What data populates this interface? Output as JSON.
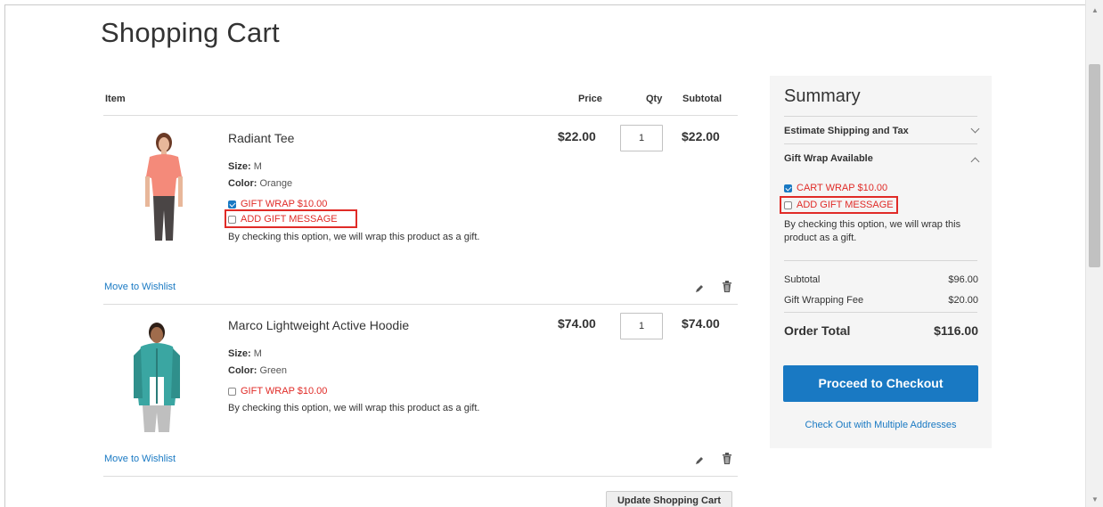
{
  "page": {
    "title": "Shopping Cart"
  },
  "table": {
    "headers": {
      "item": "Item",
      "price": "Price",
      "qty": "Qty",
      "subtotal": "Subtotal"
    }
  },
  "items": [
    {
      "name": "Radiant Tee",
      "size_label": "Size:",
      "size": "M",
      "color_label": "Color:",
      "color": "Orange",
      "gift_wrap": "GIFT WRAP $10.00",
      "gift_wrap_checked": true,
      "gift_message": "ADD GIFT MESSAGE",
      "note": "By checking this option, we will wrap this product as a gift.",
      "price": "$22.00",
      "qty": "1",
      "subtotal": "$22.00",
      "wishlist": "Move to Wishlist"
    },
    {
      "name": "Marco Lightweight Active Hoodie",
      "size_label": "Size:",
      "size": "M",
      "color_label": "Color:",
      "color": "Green",
      "gift_wrap": "GIFT WRAP $10.00",
      "gift_wrap_checked": false,
      "note": "By checking this option, we will wrap this product as a gift.",
      "price": "$74.00",
      "qty": "1",
      "subtotal": "$74.00",
      "wishlist": "Move to Wishlist"
    }
  ],
  "actions": {
    "update_cart": "Update Shopping Cart"
  },
  "summary": {
    "title": "Summary",
    "estimate": "Estimate Shipping and Tax",
    "gift_wrap_section": "Gift Wrap Available",
    "cart_wrap": "CART WRAP $10.00",
    "cart_wrap_checked": true,
    "gift_message": "ADD GIFT MESSAGE",
    "note": "By checking this option, we will wrap this product as a gift.",
    "subtotal_label": "Subtotal",
    "subtotal_value": "$96.00",
    "wrap_fee_label": "Gift Wrapping Fee",
    "wrap_fee_value": "$20.00",
    "order_total_label": "Order Total",
    "order_total_value": "$116.00",
    "checkout": "Proceed to Checkout",
    "multi": "Check Out with Multiple Addresses"
  },
  "colors": {
    "accent": "#1979c3",
    "gift": "#e02b27"
  },
  "icons": [
    "edit-icon",
    "trash-icon",
    "chevron-down-icon",
    "chevron-up-icon"
  ]
}
